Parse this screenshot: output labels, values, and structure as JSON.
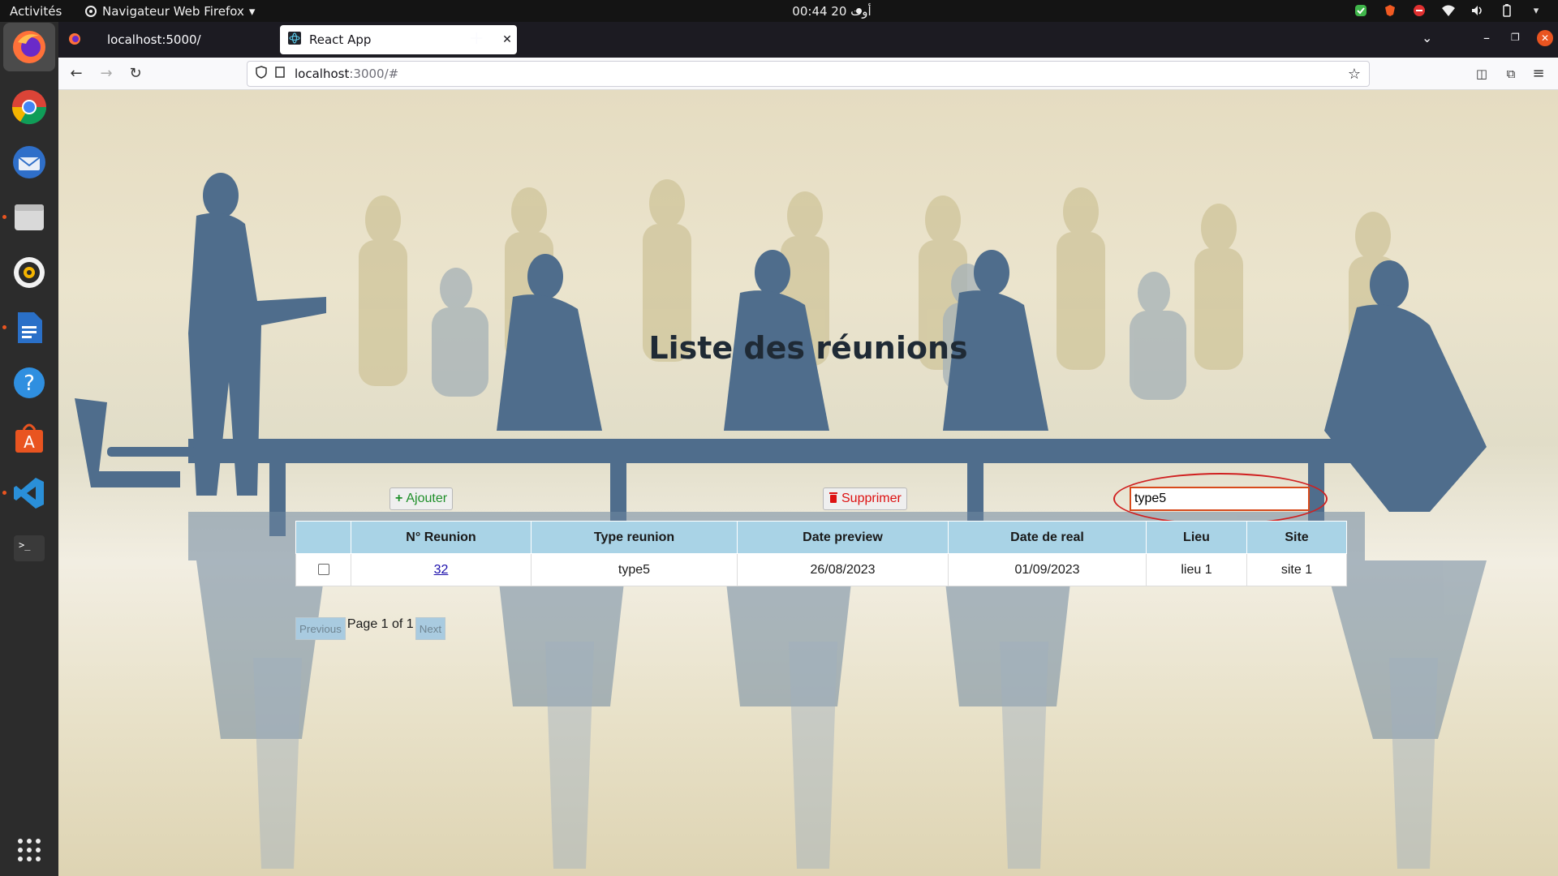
{
  "topbar": {
    "activities": "Activités",
    "app_name": "Navigateur Web Firefox",
    "clock": "00:44  20 أوت"
  },
  "browser": {
    "tabs": [
      {
        "label": "localhost:5000/"
      },
      {
        "label": "React App"
      }
    ],
    "url_host": "localhost",
    "url_path": ":3000/#"
  },
  "page": {
    "heading": "Liste des réunions",
    "add_label": "Ajouter",
    "delete_label": "Supprimer",
    "search_value": "type5",
    "columns": [
      "N° Reunion",
      "Type reunion",
      "Date preview",
      "Date de real",
      "Lieu",
      "Site"
    ],
    "rows": [
      {
        "num": "32",
        "type": "type5",
        "date_preview": "26/08/2023",
        "date_real": "01/09/2023",
        "lieu": "lieu 1",
        "site": "site 1"
      }
    ],
    "pager": {
      "previous": "Previous",
      "info": "Page 1 of 1",
      "next": "Next"
    }
  },
  "colors": {
    "accent_orange": "#e95420",
    "table_header": "#a9d3e6",
    "add_green": "#1f8f2a",
    "delete_red": "#dd1111"
  }
}
